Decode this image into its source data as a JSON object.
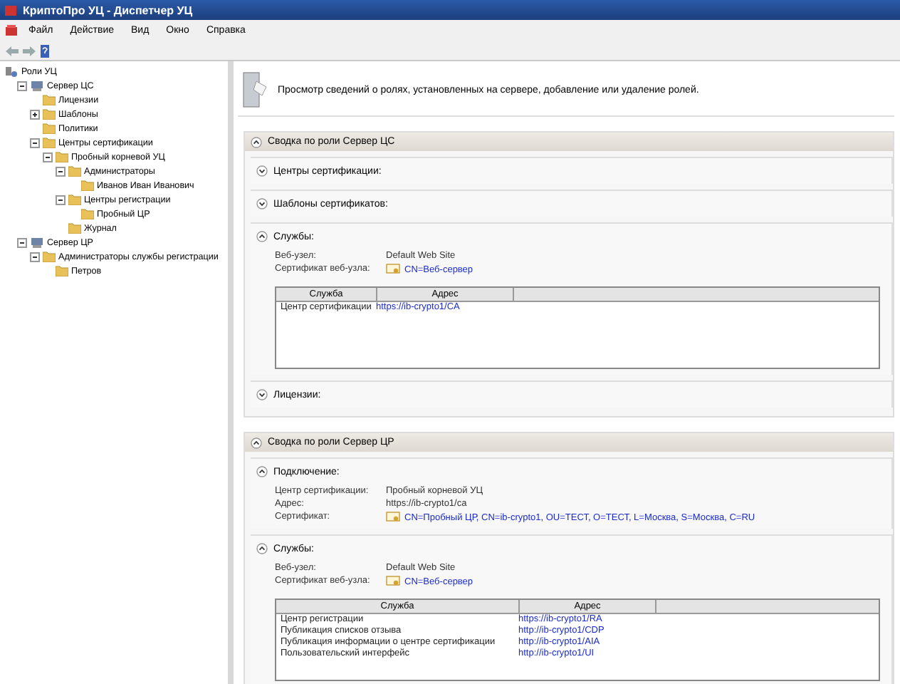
{
  "window": {
    "title": "КриптоПро УЦ - Диспетчер УЦ"
  },
  "menu": [
    "Файл",
    "Действие",
    "Вид",
    "Окно",
    "Справка"
  ],
  "tree": [
    {
      "label": "Роли УЦ",
      "kind": "root",
      "children": [
        {
          "label": "Сервер ЦС",
          "kind": "server",
          "expanded": true,
          "children": [
            {
              "label": "Лицензии",
              "kind": "folder"
            },
            {
              "label": "Шаблоны",
              "kind": "folder",
              "expanded": false
            },
            {
              "label": "Политики",
              "kind": "folder"
            },
            {
              "label": "Центры сертификации",
              "kind": "folder",
              "expanded": true,
              "children": [
                {
                  "label": "Пробный корневой УЦ",
                  "kind": "folder",
                  "expanded": true,
                  "children": [
                    {
                      "label": "Администраторы",
                      "kind": "folder",
                      "expanded": true,
                      "children": [
                        {
                          "label": "Иванов Иван Иванович",
                          "kind": "folder"
                        }
                      ]
                    },
                    {
                      "label": "Центры регистрации",
                      "kind": "folder",
                      "expanded": true,
                      "children": [
                        {
                          "label": "Пробный ЦР",
                          "kind": "folder"
                        }
                      ]
                    },
                    {
                      "label": "Журнал",
                      "kind": "folder"
                    }
                  ]
                }
              ]
            }
          ]
        },
        {
          "label": "Сервер ЦР",
          "kind": "server",
          "expanded": true,
          "children": [
            {
              "label": "Администраторы службы регистрации",
              "kind": "folder",
              "expanded": true,
              "children": [
                {
                  "label": "Петров",
                  "kind": "folder"
                }
              ]
            }
          ]
        }
      ]
    }
  ],
  "description": "Просмотр сведений о ролях, установленных на сервере, добавление или удаление ролей.",
  "roles": [
    {
      "title": "Сводка по роли Сервер ЦС",
      "expanded": true,
      "sections": [
        {
          "title": "Центры сертификации:",
          "expanded": false
        },
        {
          "title": "Шаблоны сертификатов:",
          "expanded": false
        },
        {
          "title": "Службы:",
          "expanded": true,
          "fields": [
            {
              "label": "Веб-узел:",
              "value": "Default Web Site",
              "kind": "text"
            },
            {
              "label": "Сертификат веб-узла:",
              "value": "CN=Веб-сервер",
              "kind": "cert"
            }
          ],
          "table": {
            "columns": [
              "Служба",
              "Адрес"
            ],
            "rows": [
              [
                "Центр сертификации",
                "https://ib-crypto1/CA"
              ]
            ]
          }
        },
        {
          "title": "Лицензии:",
          "expanded": false
        }
      ]
    },
    {
      "title": "Сводка по роли Сервер ЦР",
      "expanded": true,
      "sections": [
        {
          "title": "Подключение:",
          "expanded": true,
          "fields": [
            {
              "label": "Центр сертификации:",
              "value": "Пробный корневой УЦ",
              "kind": "text"
            },
            {
              "label": "Адрес:",
              "value": "https://ib-crypto1/ca",
              "kind": "text"
            },
            {
              "label": "Сертификат:",
              "value": "CN=Пробный ЦР, CN=ib-crypto1, OU=ТЕСТ, O=ТЕСТ, L=Москва, S=Москва, C=RU",
              "kind": "cert"
            }
          ]
        },
        {
          "title": "Службы:",
          "expanded": true,
          "fields": [
            {
              "label": "Веб-узел:",
              "value": "Default Web Site",
              "kind": "text"
            },
            {
              "label": "Сертификат веб-узла:",
              "value": "CN=Веб-сервер",
              "kind": "cert"
            }
          ],
          "table": {
            "columns": [
              "Служба",
              "Адрес"
            ],
            "rows": [
              [
                "Центр регистрации",
                "https://ib-crypto1/RA"
              ],
              [
                "Публикация списков отзыва",
                "http://ib-crypto1/CDP"
              ],
              [
                "Публикация информации о центре сертификации",
                "http://ib-crypto1/AIA"
              ],
              [
                "Пользовательский интерфейс",
                "http://ib-crypto1/UI"
              ]
            ]
          }
        }
      ]
    }
  ]
}
